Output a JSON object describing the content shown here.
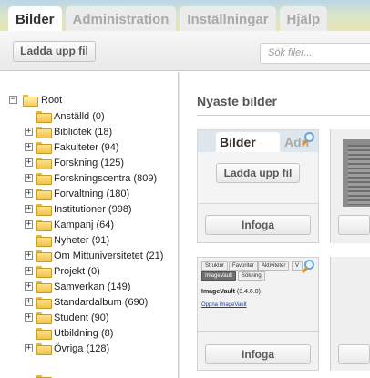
{
  "tabs": [
    {
      "label": "Bilder",
      "active": true
    },
    {
      "label": "Administration",
      "active": false
    },
    {
      "label": "Inställningar",
      "active": false
    },
    {
      "label": "Hjälp",
      "active": false
    }
  ],
  "toolbar": {
    "upload_label": "Ladda upp fil",
    "search_placeholder": "Sök filer..."
  },
  "tree": {
    "root": {
      "label": "Root"
    },
    "items": [
      {
        "label": "Anställd (0)",
        "expandable": false
      },
      {
        "label": "Bibliotek (18)",
        "expandable": true
      },
      {
        "label": "Fakulteter (94)",
        "expandable": true
      },
      {
        "label": "Forskning (125)",
        "expandable": true
      },
      {
        "label": "Forskningscentra (809)",
        "expandable": true
      },
      {
        "label": "Forvaltning (180)",
        "expandable": true
      },
      {
        "label": "Institutioner (998)",
        "expandable": true
      },
      {
        "label": "Kampanj (64)",
        "expandable": true
      },
      {
        "label": "Nyheter (91)",
        "expandable": false
      },
      {
        "label": "Om Mittuniversitetet (21)",
        "expandable": true
      },
      {
        "label": "Projekt (0)",
        "expandable": true
      },
      {
        "label": "Samverkan (149)",
        "expandable": true
      },
      {
        "label": "Standardalbum (690)",
        "expandable": true
      },
      {
        "label": "Student (90)",
        "expandable": true
      },
      {
        "label": "Utbildning (8)",
        "expandable": false
      },
      {
        "label": "Övriga (128)",
        "expandable": true
      }
    ]
  },
  "content": {
    "title": "Nyaste bilder",
    "card1": {
      "tab_active": "Bilder",
      "tab_inactive": "Adn",
      "upload_label": "Ladda upp fil",
      "insert_label": "Infoga"
    },
    "card2": {
      "tabs": [
        "Struktur",
        "Favoriter",
        "Aktiviteter",
        "V"
      ],
      "subtabs": [
        "ImageVault",
        "Sökning"
      ],
      "title": "ImageVault",
      "version": "(3.4.6.0)",
      "link": "Öppna ImageVault",
      "insert_label": "Infoga"
    }
  }
}
